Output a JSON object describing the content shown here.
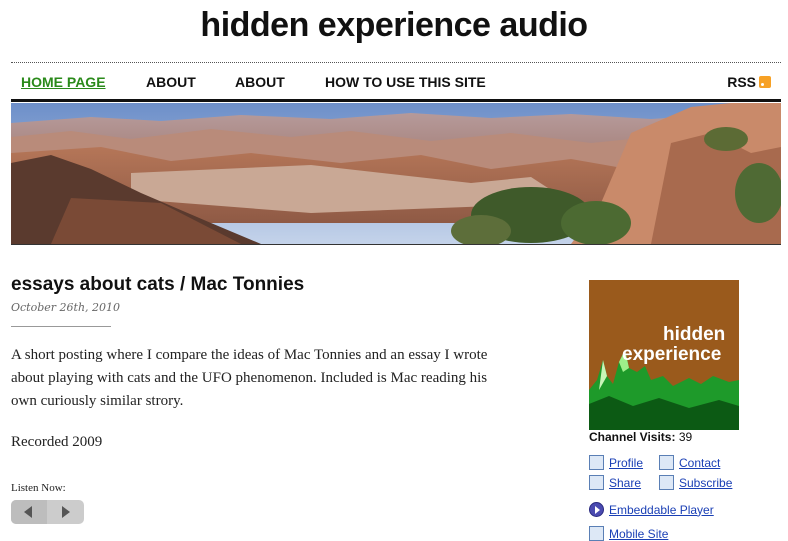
{
  "site": {
    "title": "hidden experience audio"
  },
  "nav": {
    "items": [
      {
        "label": "HOME PAGE",
        "active": true
      },
      {
        "label": "ABOUT"
      },
      {
        "label": "ABOUT"
      },
      {
        "label": "HOW TO USE THIS SITE"
      }
    ],
    "rss_label": "RSS"
  },
  "post": {
    "title": "essays about cats / Mac Tonnies",
    "date": "October 26th, 2010",
    "body": "A short posting where I compare the ideas of Mac Tonnies and an essay I wrote about playing with cats and the UFO phenomenon. Included is Mac reading his own curiously similar strory.",
    "recorded": "Recorded 2009",
    "listen_label": "Listen Now:"
  },
  "sidebar": {
    "art_line1": "hidden",
    "art_line2": "experience",
    "visits_label": "Channel Visits:",
    "visits_count": "39",
    "links": {
      "profile": "Profile",
      "contact": "Contact",
      "share": "Share",
      "subscribe": "Subscribe",
      "embeddable": "Embeddable Player",
      "mobile": "Mobile Site"
    }
  },
  "colors": {
    "nav_active": "#2a8a1a",
    "link": "#1a3fb5",
    "rss": "#f7a125",
    "art_bg": "#9a5a1c"
  }
}
